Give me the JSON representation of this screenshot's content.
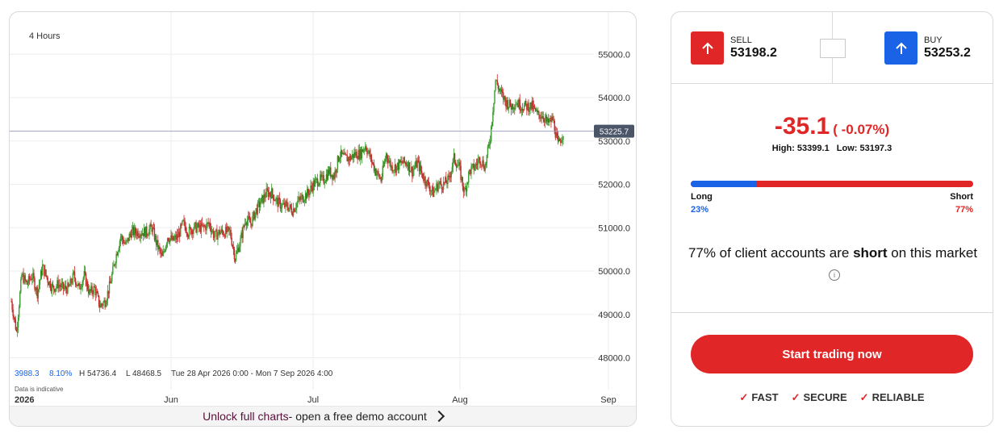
{
  "chart": {
    "timeframe": "4 Hours",
    "current_price_label": "53225.7",
    "stats": {
      "change": "3988.3",
      "change_pct": "8.10%",
      "high": "H 54736.4",
      "low": "L 48468.5",
      "range": "Tue 28 Apr 2026 0:00 - Mon 7 Sep 2026 4:00"
    },
    "disclaimer": "Data is indicative",
    "footer": {
      "link_text": "Unlock full charts",
      "rest_text": " - open a free demo account"
    },
    "colors": {
      "up": "#3a9a2e",
      "down": "#c62828",
      "price_line": "#9ea3c0",
      "price_tag": "#4a5568",
      "grid": "#eeeeee"
    }
  },
  "chart_data": {
    "type": "candlestick",
    "y_ticks": [
      "55000.0",
      "54000.0",
      "53000.0",
      "52000.0",
      "51000.0",
      "50000.0",
      "49000.0",
      "48000.0"
    ],
    "ylim": [
      47600,
      55600
    ],
    "x_ticks": [
      "2026",
      "Jun",
      "Jul",
      "Aug",
      "Sep"
    ],
    "current_price": 53225.7,
    "series": [
      {
        "name": "",
        "values": [
          49300,
          48600,
          49900,
          49700,
          49900,
          49500,
          50100,
          49800,
          49600,
          49700,
          49600,
          49600,
          49900,
          49600,
          49900,
          49500,
          49600,
          49200,
          49300,
          49700,
          50300,
          50800,
          50600,
          50900,
          50900,
          50900,
          50900,
          51000,
          50600,
          50300,
          50800,
          50700,
          50800,
          51100,
          50900,
          51000,
          51000,
          51000,
          51100,
          50800,
          50900,
          50900,
          50900,
          50300,
          50700,
          51200,
          51100,
          51400,
          51600,
          51800,
          51800,
          51600,
          51500,
          51500,
          51400,
          51600,
          51700,
          51800,
          52000,
          52100,
          52100,
          52300,
          52200,
          52700,
          52600,
          52600,
          52700,
          52700,
          52900,
          52600,
          52300,
          52100,
          52700,
          52400,
          52400,
          52500,
          52500,
          52300,
          52500,
          52200,
          52000,
          51800,
          52000,
          52000,
          52100,
          52600,
          52400,
          51800,
          52300,
          52400,
          52600,
          52400,
          53100,
          54400,
          54100,
          53900,
          53800,
          53900,
          53800,
          53800,
          53800,
          53600,
          53600,
          53400,
          53500,
          52900,
          53200
        ]
      }
    ]
  },
  "quote": {
    "sell_label": "SELL",
    "sell_price": "53198.2",
    "buy_label": "BUY",
    "buy_price": "53253.2"
  },
  "change": {
    "value": "-35.1",
    "pct": "( -0.07%)",
    "high": "High: 53399.1",
    "low": "Low: 53197.3"
  },
  "sentiment": {
    "long_label": "Long",
    "short_label": "Short",
    "long_pct": "23%",
    "short_pct": "77%",
    "long_fraction": 0.23,
    "statement_prefix": "77% of client accounts are ",
    "statement_bold": "short",
    "statement_suffix": " on this market"
  },
  "cta": {
    "label": "Start trading now"
  },
  "features": [
    "FAST",
    "SECURE",
    "RELIABLE"
  ]
}
